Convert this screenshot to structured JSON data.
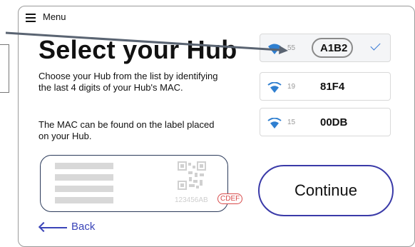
{
  "menu": {
    "label": "Menu"
  },
  "page": {
    "title": "Select your Hub",
    "instructions": "Choose your Hub from the list by identifying the last 4 digits of your Hub's MAC.",
    "mac_hint": "The MAC can be found on the label placed on your Hub."
  },
  "label_example": {
    "mac_prefix": "123456AB",
    "mac_suffix": "CDEF"
  },
  "hubs": [
    {
      "signal": "55",
      "name": "A1B2",
      "selected": true
    },
    {
      "signal": "19",
      "name": "81F4",
      "selected": false
    },
    {
      "signal": "15",
      "name": "00DB",
      "selected": false
    }
  ],
  "actions": {
    "continue_label": "Continue",
    "back_label": "Back"
  },
  "colors": {
    "accent": "#3a44b8",
    "wifi": "#2f7fd0",
    "highlight": "#d84a4a"
  }
}
